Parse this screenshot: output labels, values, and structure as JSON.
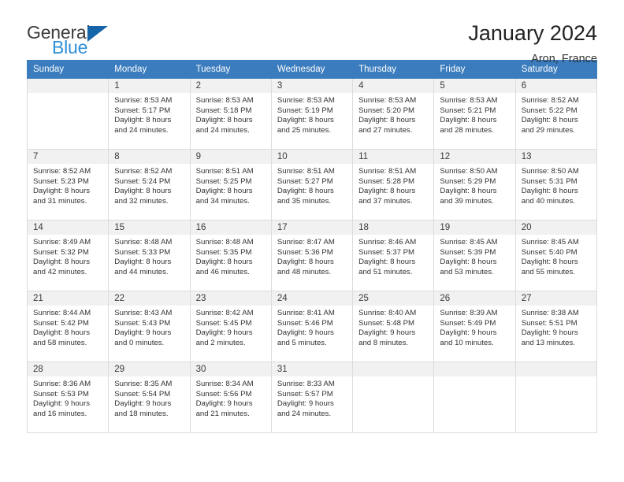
{
  "brand": {
    "name_part1": "General",
    "name_part2": "Blue",
    "triangle_color": "#1565a8",
    "blue_text_color": "#2f8fd6"
  },
  "header": {
    "title": "January 2024",
    "subtitle": "Aron, France"
  },
  "theme": {
    "header_row_bg": "#3a7cbe",
    "header_row_text": "#ffffff",
    "daynum_bg": "#f1f1f1",
    "cell_border": "#dcdcdc"
  },
  "weekdays": [
    "Sunday",
    "Monday",
    "Tuesday",
    "Wednesday",
    "Thursday",
    "Friday",
    "Saturday"
  ],
  "labels": {
    "sunrise_prefix": "Sunrise:",
    "sunset_prefix": "Sunset:",
    "daylight_prefix": "Daylight:"
  },
  "weeks": [
    [
      {
        "day": "",
        "sunrise": "",
        "sunset": "",
        "daylight_line1": "",
        "daylight_line2": ""
      },
      {
        "day": "1",
        "sunrise": "Sunrise: 8:53 AM",
        "sunset": "Sunset: 5:17 PM",
        "daylight_line1": "Daylight: 8 hours",
        "daylight_line2": "and 24 minutes."
      },
      {
        "day": "2",
        "sunrise": "Sunrise: 8:53 AM",
        "sunset": "Sunset: 5:18 PM",
        "daylight_line1": "Daylight: 8 hours",
        "daylight_line2": "and 24 minutes."
      },
      {
        "day": "3",
        "sunrise": "Sunrise: 8:53 AM",
        "sunset": "Sunset: 5:19 PM",
        "daylight_line1": "Daylight: 8 hours",
        "daylight_line2": "and 25 minutes."
      },
      {
        "day": "4",
        "sunrise": "Sunrise: 8:53 AM",
        "sunset": "Sunset: 5:20 PM",
        "daylight_line1": "Daylight: 8 hours",
        "daylight_line2": "and 27 minutes."
      },
      {
        "day": "5",
        "sunrise": "Sunrise: 8:53 AM",
        "sunset": "Sunset: 5:21 PM",
        "daylight_line1": "Daylight: 8 hours",
        "daylight_line2": "and 28 minutes."
      },
      {
        "day": "6",
        "sunrise": "Sunrise: 8:52 AM",
        "sunset": "Sunset: 5:22 PM",
        "daylight_line1": "Daylight: 8 hours",
        "daylight_line2": "and 29 minutes."
      }
    ],
    [
      {
        "day": "7",
        "sunrise": "Sunrise: 8:52 AM",
        "sunset": "Sunset: 5:23 PM",
        "daylight_line1": "Daylight: 8 hours",
        "daylight_line2": "and 31 minutes."
      },
      {
        "day": "8",
        "sunrise": "Sunrise: 8:52 AM",
        "sunset": "Sunset: 5:24 PM",
        "daylight_line1": "Daylight: 8 hours",
        "daylight_line2": "and 32 minutes."
      },
      {
        "day": "9",
        "sunrise": "Sunrise: 8:51 AM",
        "sunset": "Sunset: 5:25 PM",
        "daylight_line1": "Daylight: 8 hours",
        "daylight_line2": "and 34 minutes."
      },
      {
        "day": "10",
        "sunrise": "Sunrise: 8:51 AM",
        "sunset": "Sunset: 5:27 PM",
        "daylight_line1": "Daylight: 8 hours",
        "daylight_line2": "and 35 minutes."
      },
      {
        "day": "11",
        "sunrise": "Sunrise: 8:51 AM",
        "sunset": "Sunset: 5:28 PM",
        "daylight_line1": "Daylight: 8 hours",
        "daylight_line2": "and 37 minutes."
      },
      {
        "day": "12",
        "sunrise": "Sunrise: 8:50 AM",
        "sunset": "Sunset: 5:29 PM",
        "daylight_line1": "Daylight: 8 hours",
        "daylight_line2": "and 39 minutes."
      },
      {
        "day": "13",
        "sunrise": "Sunrise: 8:50 AM",
        "sunset": "Sunset: 5:31 PM",
        "daylight_line1": "Daylight: 8 hours",
        "daylight_line2": "and 40 minutes."
      }
    ],
    [
      {
        "day": "14",
        "sunrise": "Sunrise: 8:49 AM",
        "sunset": "Sunset: 5:32 PM",
        "daylight_line1": "Daylight: 8 hours",
        "daylight_line2": "and 42 minutes."
      },
      {
        "day": "15",
        "sunrise": "Sunrise: 8:48 AM",
        "sunset": "Sunset: 5:33 PM",
        "daylight_line1": "Daylight: 8 hours",
        "daylight_line2": "and 44 minutes."
      },
      {
        "day": "16",
        "sunrise": "Sunrise: 8:48 AM",
        "sunset": "Sunset: 5:35 PM",
        "daylight_line1": "Daylight: 8 hours",
        "daylight_line2": "and 46 minutes."
      },
      {
        "day": "17",
        "sunrise": "Sunrise: 8:47 AM",
        "sunset": "Sunset: 5:36 PM",
        "daylight_line1": "Daylight: 8 hours",
        "daylight_line2": "and 48 minutes."
      },
      {
        "day": "18",
        "sunrise": "Sunrise: 8:46 AM",
        "sunset": "Sunset: 5:37 PM",
        "daylight_line1": "Daylight: 8 hours",
        "daylight_line2": "and 51 minutes."
      },
      {
        "day": "19",
        "sunrise": "Sunrise: 8:45 AM",
        "sunset": "Sunset: 5:39 PM",
        "daylight_line1": "Daylight: 8 hours",
        "daylight_line2": "and 53 minutes."
      },
      {
        "day": "20",
        "sunrise": "Sunrise: 8:45 AM",
        "sunset": "Sunset: 5:40 PM",
        "daylight_line1": "Daylight: 8 hours",
        "daylight_line2": "and 55 minutes."
      }
    ],
    [
      {
        "day": "21",
        "sunrise": "Sunrise: 8:44 AM",
        "sunset": "Sunset: 5:42 PM",
        "daylight_line1": "Daylight: 8 hours",
        "daylight_line2": "and 58 minutes."
      },
      {
        "day": "22",
        "sunrise": "Sunrise: 8:43 AM",
        "sunset": "Sunset: 5:43 PM",
        "daylight_line1": "Daylight: 9 hours",
        "daylight_line2": "and 0 minutes."
      },
      {
        "day": "23",
        "sunrise": "Sunrise: 8:42 AM",
        "sunset": "Sunset: 5:45 PM",
        "daylight_line1": "Daylight: 9 hours",
        "daylight_line2": "and 2 minutes."
      },
      {
        "day": "24",
        "sunrise": "Sunrise: 8:41 AM",
        "sunset": "Sunset: 5:46 PM",
        "daylight_line1": "Daylight: 9 hours",
        "daylight_line2": "and 5 minutes."
      },
      {
        "day": "25",
        "sunrise": "Sunrise: 8:40 AM",
        "sunset": "Sunset: 5:48 PM",
        "daylight_line1": "Daylight: 9 hours",
        "daylight_line2": "and 8 minutes."
      },
      {
        "day": "26",
        "sunrise": "Sunrise: 8:39 AM",
        "sunset": "Sunset: 5:49 PM",
        "daylight_line1": "Daylight: 9 hours",
        "daylight_line2": "and 10 minutes."
      },
      {
        "day": "27",
        "sunrise": "Sunrise: 8:38 AM",
        "sunset": "Sunset: 5:51 PM",
        "daylight_line1": "Daylight: 9 hours",
        "daylight_line2": "and 13 minutes."
      }
    ],
    [
      {
        "day": "28",
        "sunrise": "Sunrise: 8:36 AM",
        "sunset": "Sunset: 5:53 PM",
        "daylight_line1": "Daylight: 9 hours",
        "daylight_line2": "and 16 minutes."
      },
      {
        "day": "29",
        "sunrise": "Sunrise: 8:35 AM",
        "sunset": "Sunset: 5:54 PM",
        "daylight_line1": "Daylight: 9 hours",
        "daylight_line2": "and 18 minutes."
      },
      {
        "day": "30",
        "sunrise": "Sunrise: 8:34 AM",
        "sunset": "Sunset: 5:56 PM",
        "daylight_line1": "Daylight: 9 hours",
        "daylight_line2": "and 21 minutes."
      },
      {
        "day": "31",
        "sunrise": "Sunrise: 8:33 AM",
        "sunset": "Sunset: 5:57 PM",
        "daylight_line1": "Daylight: 9 hours",
        "daylight_line2": "and 24 minutes."
      },
      {
        "day": "",
        "sunrise": "",
        "sunset": "",
        "daylight_line1": "",
        "daylight_line2": ""
      },
      {
        "day": "",
        "sunrise": "",
        "sunset": "",
        "daylight_line1": "",
        "daylight_line2": ""
      },
      {
        "day": "",
        "sunrise": "",
        "sunset": "",
        "daylight_line1": "",
        "daylight_line2": ""
      }
    ]
  ]
}
